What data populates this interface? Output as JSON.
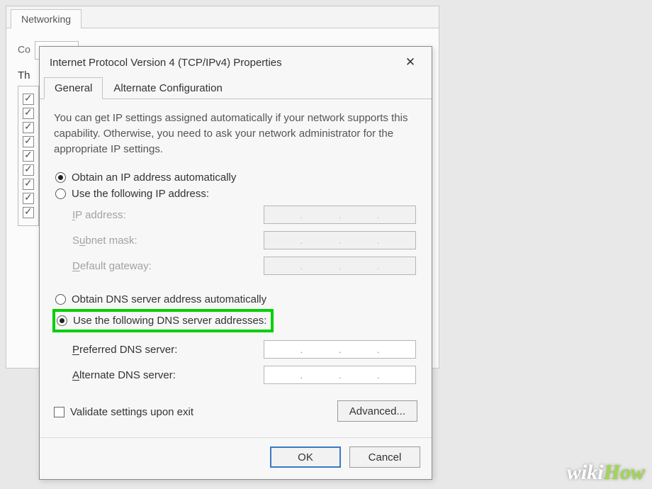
{
  "background": {
    "tab": "Networking",
    "partial1": "Co",
    "th": "Th"
  },
  "dialog": {
    "title": "Internet Protocol Version 4 (TCP/IPv4) Properties",
    "close": "✕",
    "tabs": [
      {
        "label": "General",
        "active": true
      },
      {
        "label": "Alternate Configuration",
        "active": false
      }
    ],
    "description": "You can get IP settings assigned automatically if your network supports this capability. Otherwise, you need to ask your network administrator for the appropriate IP settings.",
    "ip": {
      "auto_label": "Obtain an IP address automatically",
      "manual_label": "Use the following IP address:",
      "selected": "auto",
      "fields": {
        "ip_address": "IP address:",
        "subnet_mask": "Subnet mask:",
        "default_gateway": "Default gateway:"
      }
    },
    "dns": {
      "auto_label": "Obtain DNS server address automatically",
      "manual_label": "Use the following DNS server addresses:",
      "selected": "manual",
      "fields": {
        "preferred": "Preferred DNS server:",
        "alternate": "Alternate DNS server:"
      }
    },
    "validate_label": "Validate settings upon exit",
    "advanced_label": "Advanced...",
    "ok_label": "OK",
    "cancel_label": "Cancel"
  },
  "watermark": {
    "wiki": "wiki",
    "how": "How"
  }
}
